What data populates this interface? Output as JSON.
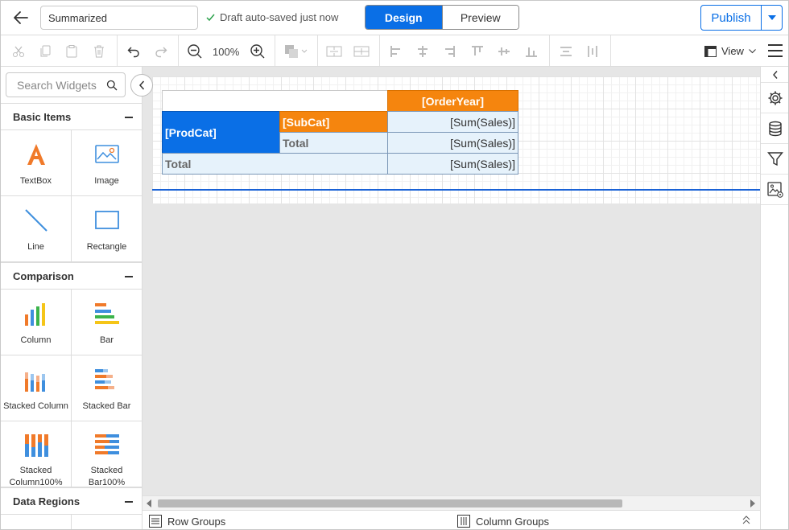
{
  "header": {
    "report_name": "Summarized",
    "save_status": "Draft auto-saved just now",
    "tabs": [
      {
        "label": "Design",
        "active": true
      },
      {
        "label": "Preview",
        "active": false
      }
    ],
    "publish_label": "Publish"
  },
  "toolbar": {
    "zoom": "100%",
    "view_label": "View",
    "icons": [
      "cut-icon",
      "copy-icon",
      "paste-icon",
      "delete-icon",
      "undo-icon",
      "redo-icon",
      "zoom-out-icon",
      "zoom-in-icon",
      "fill-color-icon",
      "align-left-icon",
      "align-center-icon",
      "align-right-icon",
      "align-top-icon",
      "align-middle-icon",
      "align-bottom-icon",
      "distribute-horizontal-icon",
      "distribute-vertical-icon"
    ]
  },
  "left_panel": {
    "search_placeholder": "Search Widgets",
    "sections": [
      {
        "title": "Basic Items",
        "items": [
          "TextBox",
          "Image",
          "Line",
          "Rectangle"
        ]
      },
      {
        "title": "Comparison",
        "items": [
          "Column",
          "Bar",
          "Stacked Column",
          "Stacked Bar",
          "Stacked Column100%",
          "Stacked Bar100%"
        ]
      },
      {
        "title": "Data Regions",
        "items": []
      }
    ]
  },
  "tablix": {
    "order_year": "[OrderYear]",
    "prod_cat": "[ProdCat]",
    "sub_cat": "[SubCat]",
    "total_sub": "Total",
    "total_grand": "Total",
    "values": [
      "[Sum(Sales)]",
      "[Sum(Sales)]",
      "[Sum(Sales)]"
    ]
  },
  "bottom_bar": {
    "row_groups": "Row Groups",
    "column_groups": "Column Groups"
  },
  "colors": {
    "accent": "#0a6fe6",
    "header_orange": "#f5850e",
    "value_cell": "#e6f2fb"
  },
  "right_rail": [
    "chevron-left-icon",
    "settings-icon",
    "data-icon",
    "filter-icon",
    "image-settings-icon"
  ]
}
